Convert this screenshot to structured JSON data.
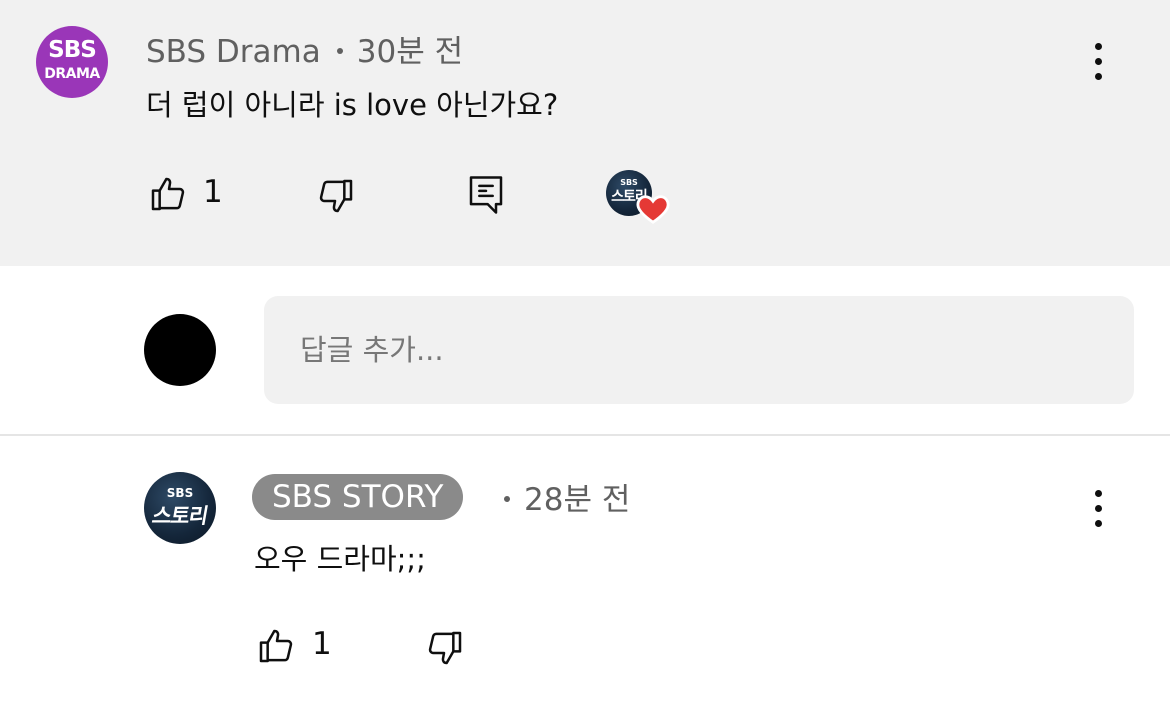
{
  "comment_top": {
    "avatar_line1": "SBS",
    "avatar_line2": "DRAMA",
    "author": "SBS Drama",
    "time": "30분 전",
    "text": "더 럽이 아니라 is love 아닌가요?",
    "like_count": "1"
  },
  "creator_heart": {
    "avatar_line1": "SBS",
    "avatar_line2": "스토리",
    "heart_color": "#e53935"
  },
  "reply_input": {
    "placeholder": "답글 추가..."
  },
  "comment_bottom": {
    "avatar_line1": "SBS",
    "avatar_line2": "스토리",
    "author": "SBS STORY",
    "time": "28분 전",
    "text": "오우 드라마;;;",
    "like_count": "1"
  },
  "colors": {
    "highlight_bg": "#f1f1f1",
    "sbs_drama_purple": "#9a36b8",
    "pill_gray": "#8a8a8a",
    "meta_gray": "#606060"
  },
  "icons": [
    "thumbs-up-icon",
    "thumbs-down-icon",
    "reply-icon",
    "more-vert-icon",
    "heart-icon"
  ]
}
